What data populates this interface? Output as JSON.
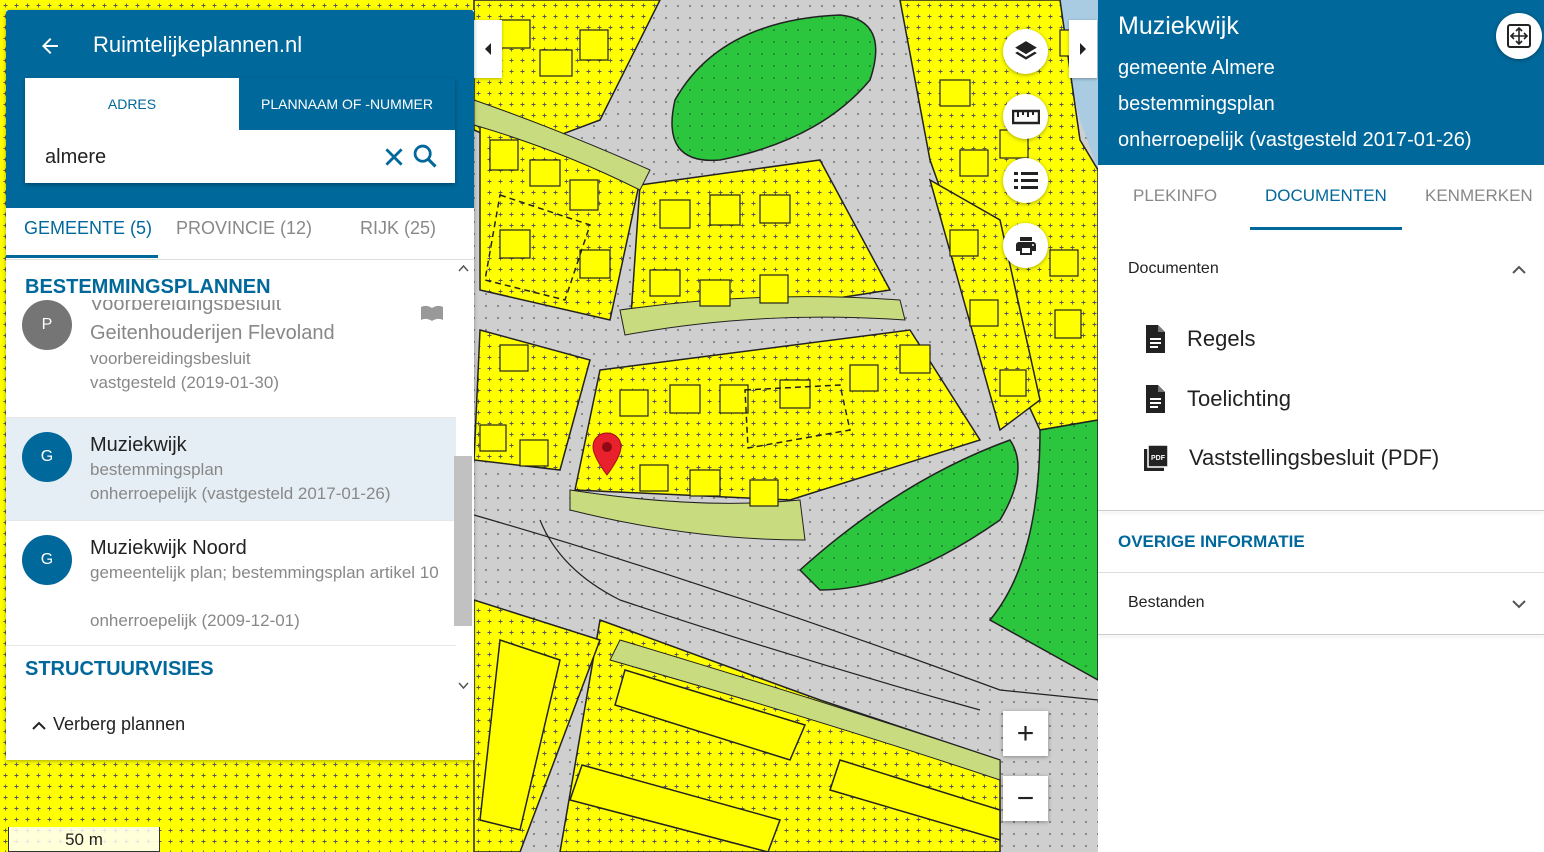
{
  "left_panel": {
    "title": "Ruimtelijkeplannen.nl",
    "search_tabs": {
      "address": "ADRES",
      "plan": "PLANNAAM OF -NUMMER"
    },
    "search": {
      "value": "almere",
      "placeholder": ""
    },
    "level_tabs": [
      "GEMEENTE (5)",
      "PROVINCIE (12)",
      "RIJK (25)"
    ],
    "sections": {
      "bestemmingsplannen": "BESTEMMINGSPLANNEN",
      "structuurvisies": "STRUCTUURVISIES"
    },
    "plans": [
      {
        "avatar": "P",
        "title_partial": "Voorbereidingsbesluit",
        "title": "Geitenhouderijen Flevoland",
        "type": "voorbereidingsbesluit",
        "status": "vastgesteld (2019-01-30)"
      },
      {
        "avatar": "G",
        "title": "Muziekwijk",
        "type": "bestemmingsplan",
        "status": "onherroepelijk (vastgesteld 2017-01-26)"
      },
      {
        "avatar": "G",
        "title": "Muziekwijk Noord",
        "type": "gemeentelijk plan; bestemmingsplan artikel 10",
        "status": "onherroepelijk (2009-12-01)"
      }
    ],
    "toggle_label": "Verberg plannen"
  },
  "map": {
    "scale_label": "50 m",
    "zoom_in": "+",
    "zoom_out": "−"
  },
  "right_panel": {
    "title": "Muziekwijk",
    "municipality": "gemeente Almere",
    "plan_type": "bestemmingsplan",
    "status": "onherroepelijk (vastgesteld 2017-01-26)",
    "tabs": [
      "PLEKINFO",
      "DOCUMENTEN",
      "KENMERKEN"
    ],
    "documents_header": "Documenten",
    "documents": [
      "Regels",
      "Toelichting",
      "Vaststellingsbesluit (PDF)"
    ],
    "other_info_title": "OVERIGE INFORMATIE",
    "files_header": "Bestanden"
  },
  "colors": {
    "primary": "#01689b",
    "residential": "#ffff00",
    "green": "#2bc63d",
    "road": "#cfcfcf",
    "garden": "#c8db7e",
    "pin": "#e8212c",
    "avatar_provincie": "#757575"
  }
}
